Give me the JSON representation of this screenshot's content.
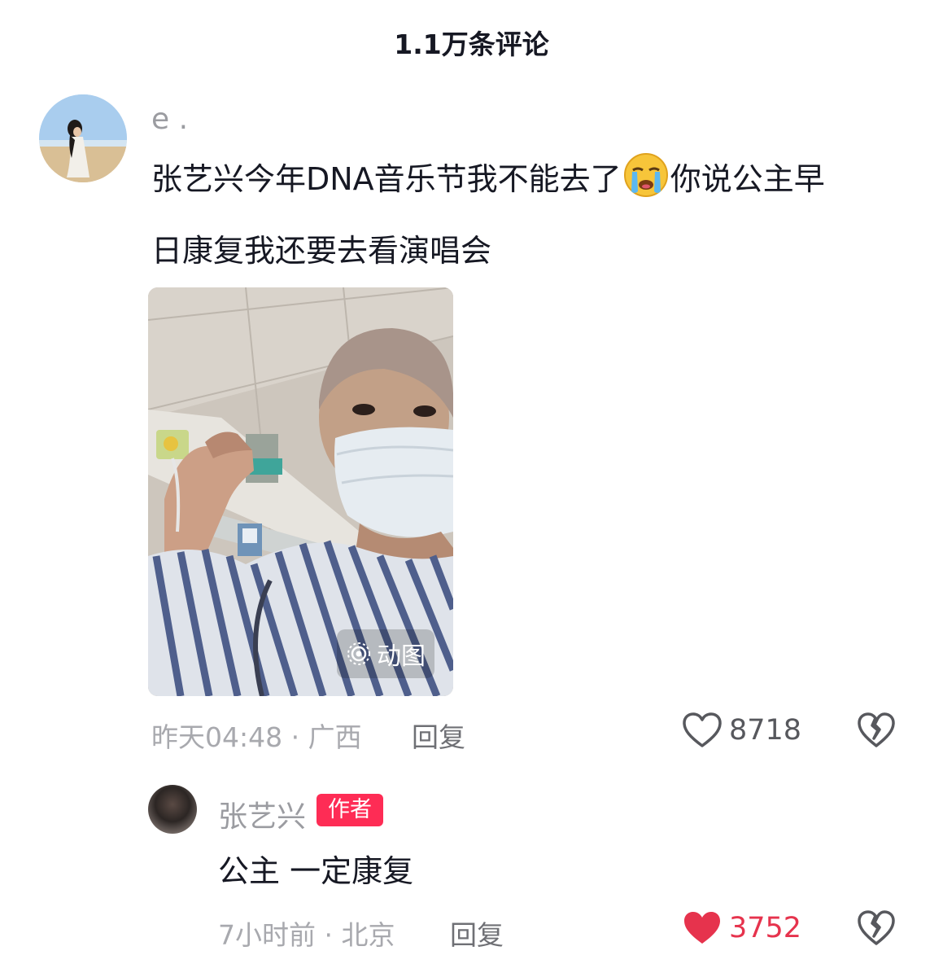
{
  "header": {
    "title": "1.1万条评论"
  },
  "comment": {
    "username": "e .",
    "text_line1_before": "张艺兴今年DNA音乐节我不能去了",
    "text_line1_after": "你说公主早",
    "text_line2": "日康复我还要去看演唱会",
    "gif_badge": "动图",
    "time_location": "昨天04:48 · 广西",
    "reply_label": "回复",
    "like_count": "8718",
    "colors": {
      "like_default": "#57585d"
    }
  },
  "reply": {
    "username": "张艺兴",
    "author_badge": "作者",
    "text": "公主 一定康复",
    "time_location": "7小时前 · 北京",
    "reply_label": "回复",
    "like_count": "3752",
    "colors": {
      "like_active": "#e6334d",
      "badge": "#fe2c55"
    }
  }
}
